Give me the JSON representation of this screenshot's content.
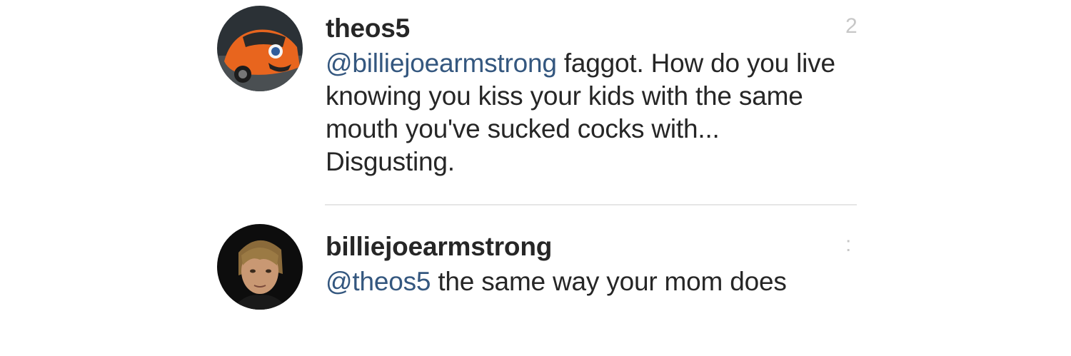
{
  "comments": [
    {
      "username": "theos5",
      "mention": "@billiejoearmstrong",
      "text": " faggot. How do you live knowing you kiss your kids with the same mouth you've sucked cocks with... Disgusting.",
      "timestamp": "2",
      "avatar_icon": "orange-car-avatar-icon"
    },
    {
      "username": "billiejoearmstrong",
      "mention": "@theos5",
      "text": " the same way your mom does",
      "timestamp": ":",
      "avatar_icon": "person-avatar-icon"
    }
  ],
  "colors": {
    "text": "#262626",
    "mention": "#34577f",
    "divider": "#e6e6e6",
    "timestamp": "#c7c7c7"
  }
}
